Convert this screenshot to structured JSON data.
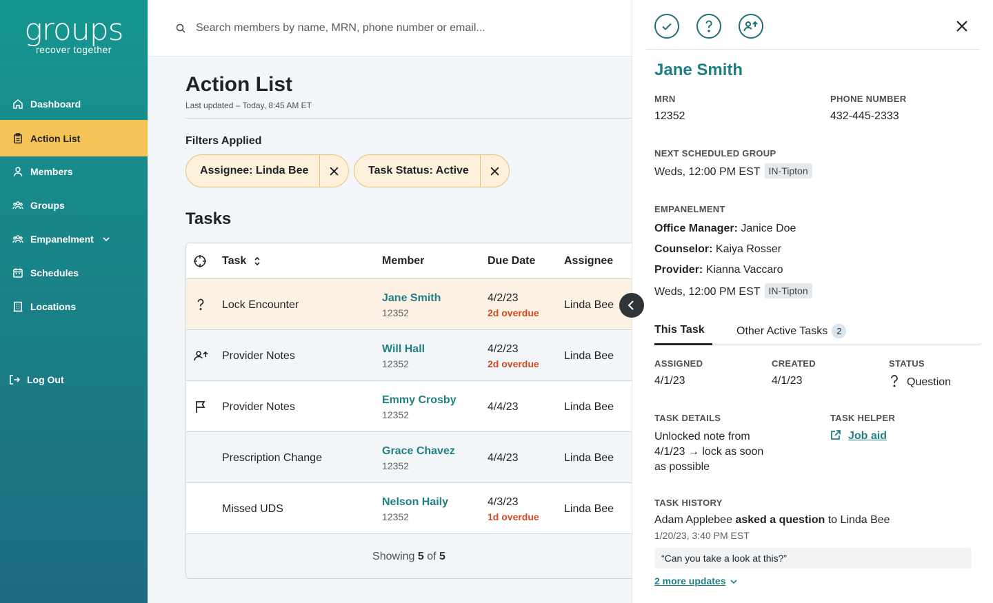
{
  "brand": {
    "logo": "groups",
    "tagline": "recover together"
  },
  "sidebar": {
    "items": [
      {
        "label": "Dashboard",
        "icon": "home-icon"
      },
      {
        "label": "Action List",
        "icon": "clipboard-icon"
      },
      {
        "label": "Members",
        "icon": "user-icon"
      },
      {
        "label": "Groups",
        "icon": "users-icon"
      },
      {
        "label": "Empanelment",
        "icon": "users-icon"
      },
      {
        "label": "Schedules",
        "icon": "calendar-icon"
      },
      {
        "label": "Locations",
        "icon": "building-icon"
      }
    ],
    "logout": "Log Out"
  },
  "search": {
    "placeholder": "Search members by name, MRN, phone number or email..."
  },
  "main": {
    "title": "Action List",
    "last_updated": "Last updated – Today, 8:45 AM ET",
    "filters_label": "Filters Applied",
    "filters": [
      "Assignee: Linda Bee",
      "Task Status: Active"
    ],
    "tasks_title": "Tasks",
    "columns": {
      "task": "Task",
      "member": "Member",
      "due": "Due Date",
      "assignee": "Assignee"
    },
    "rows": [
      {
        "icon": "question-icon",
        "task": "Lock Encounter",
        "member": "Jane Smith",
        "mrn": "12352",
        "due": "4/2/23",
        "overdue": "2d overdue",
        "assignee": "Linda Bee"
      },
      {
        "icon": "user-transfer-icon",
        "task": "Provider Notes",
        "member": "Will Hall",
        "mrn": "12352",
        "due": "4/2/23",
        "overdue": "2d overdue",
        "assignee": "Linda Bee"
      },
      {
        "icon": "flag-icon",
        "task": "Provider Notes",
        "member": "Emmy Crosby",
        "mrn": "12352",
        "due": "4/4/23",
        "overdue": "",
        "assignee": "Linda Bee"
      },
      {
        "icon": "",
        "task": "Prescription Change",
        "member": "Grace Chavez",
        "mrn": "12352",
        "due": "4/4/23",
        "overdue": "",
        "assignee": "Linda Bee"
      },
      {
        "icon": "",
        "task": "Missed UDS",
        "member": "Nelson Haily",
        "mrn": "12352",
        "due": "4/3/23",
        "overdue": "1d overdue",
        "assignee": "Linda Bee"
      }
    ],
    "footer": {
      "prefix": "Showing",
      "shown": "5",
      "of": "of",
      "total": "5"
    }
  },
  "panel": {
    "name": "Jane Smith",
    "mrn_label": "MRN",
    "mrn": "12352",
    "phone_label": "PHONE NUMBER",
    "phone": "432-445-2333",
    "next_group_label": "NEXT SCHEDULED GROUP",
    "next_group": "Weds, 12:00 PM EST",
    "next_group_tag": "IN-Tipton",
    "empanelment_label": "EMPANELMENT",
    "office_manager_label": "Office Manager:",
    "office_manager": "Janice Doe",
    "counselor_label": "Counselor:",
    "counselor": "Kaiya Rosser",
    "provider_label": "Provider:",
    "provider": "Kianna Vaccaro",
    "empanel_time": "Weds, 12:00 PM EST",
    "empanel_tag": "IN-Tipton",
    "tabs": {
      "this_task": "This Task",
      "other": "Other Active Tasks",
      "other_count": "2"
    },
    "assigned_label": "ASSIGNED",
    "assigned": "4/1/23",
    "created_label": "CREATED",
    "created": "4/1/23",
    "status_label": "STATUS",
    "status": "Question",
    "details_label": "TASK DETAILS",
    "details_lines": [
      "Unlocked note from",
      "4/1/23 → lock as soon",
      "as possible"
    ],
    "helper_label": "TASK HELPER",
    "helper_link": "Job aid",
    "history_label": "TASK HISTORY",
    "history": {
      "actor": "Adam Applebee",
      "action": "asked a question",
      "to": "to Linda Bee",
      "time": "1/20/23, 3:40 PM EST",
      "quote": "“Can you take a look at this?”"
    },
    "more_updates": "2 more updates"
  },
  "colors": {
    "teal": "#1f7f83",
    "accent": "#f4c257",
    "overdue": "#cf4a23"
  }
}
